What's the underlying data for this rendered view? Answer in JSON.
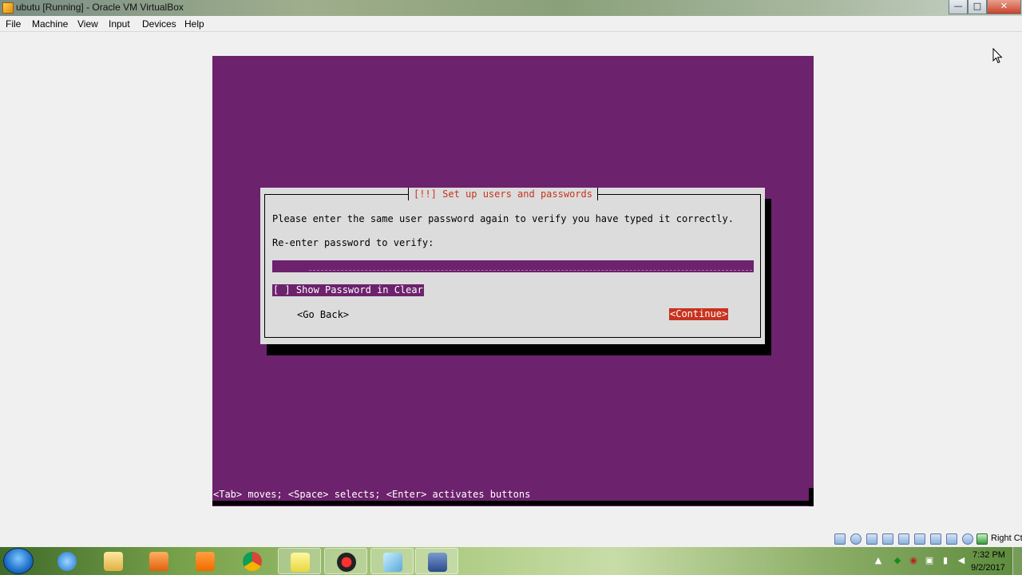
{
  "window": {
    "title": "ubutu [Running] - Oracle VM VirtualBox",
    "minimize_glyph": "—",
    "maximize_glyph": "□",
    "close_glyph": "✕"
  },
  "menu": {
    "items": [
      "File",
      "Machine",
      "View",
      "Input",
      "Devices",
      "Help"
    ]
  },
  "installer": {
    "dialog_title": "[!!] Set up users and passwords",
    "prompt": "Please enter the same user password again to verify you have typed it correctly.",
    "field_label": "Re-enter password to verify:",
    "password_value": "****",
    "show_password_label": "[ ] Show Password in Clear",
    "go_back_label": "<Go Back>",
    "continue_label": "<Continue>",
    "hint": "<Tab> moves; <Space> selects; <Enter> activates buttons"
  },
  "statusbar": {
    "host_key": "Right Ctrl"
  },
  "taskbar": {
    "time": "7:32 PM",
    "date": "9/2/2017"
  },
  "colors": {
    "vm_background": "#6c226c",
    "dialog_background": "#dcdcdc",
    "accent_red": "#c8321e"
  }
}
